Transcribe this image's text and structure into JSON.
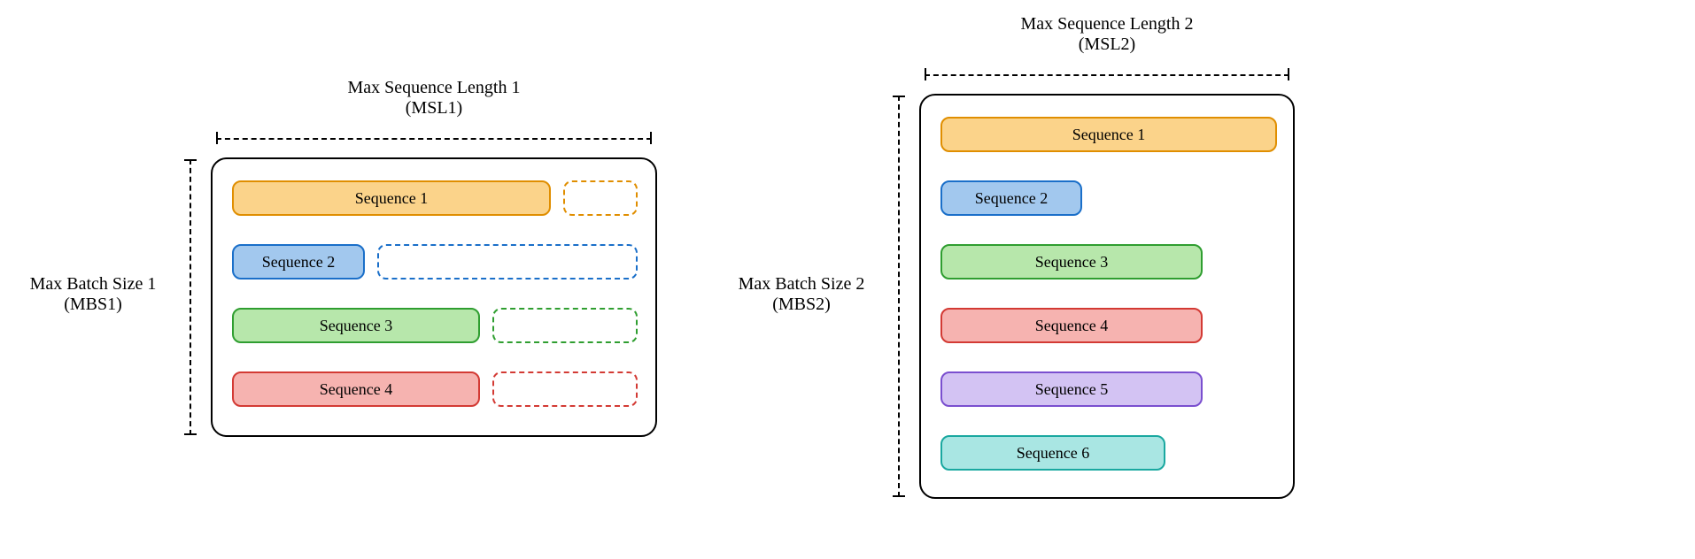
{
  "left": {
    "msl_label_line1": "Max Sequence Length 1",
    "msl_label_line2": "(MSL1)",
    "mbs_label_line1": "Max Batch Size 1",
    "mbs_label_line2": "(MBS1)",
    "sequences": [
      {
        "label": "Sequence 1"
      },
      {
        "label": "Sequence 2"
      },
      {
        "label": "Sequence 3"
      },
      {
        "label": "Sequence 4"
      }
    ]
  },
  "right": {
    "msl_label_line1": "Max Sequence Length 2",
    "msl_label_line2": "(MSL2)",
    "mbs_label_line1": "Max Batch Size 2",
    "mbs_label_line2": "(MBS2)",
    "sequences": [
      {
        "label": "Sequence 1"
      },
      {
        "label": "Sequence 2"
      },
      {
        "label": "Sequence 3"
      },
      {
        "label": "Sequence 4"
      },
      {
        "label": "Sequence 5"
      },
      {
        "label": "Sequence 6"
      }
    ]
  },
  "meta": {
    "description": "Two batch containers comparing max sequence length vs max batch size. Left shorter batch with padding slots dashed. Right taller batch with more sequences."
  }
}
